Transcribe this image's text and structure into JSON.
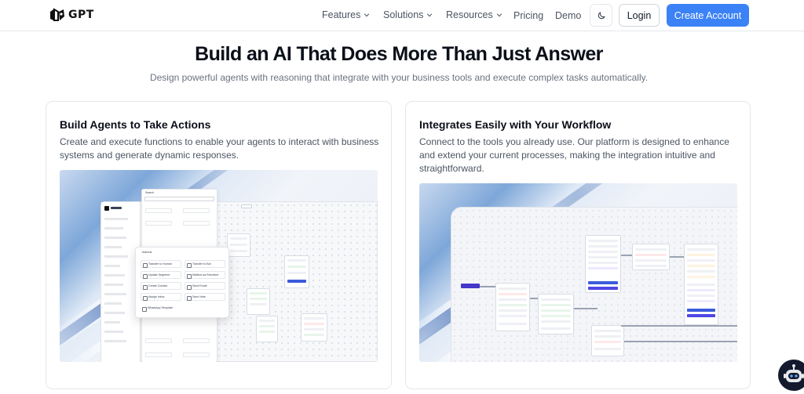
{
  "nav": {
    "logo_text": "GPT",
    "items": [
      {
        "label": "Features",
        "has_dropdown": true
      },
      {
        "label": "Solutions",
        "has_dropdown": true
      },
      {
        "label": "Resources",
        "has_dropdown": true
      },
      {
        "label": "Pricing",
        "has_dropdown": false
      },
      {
        "label": "Demo",
        "has_dropdown": false
      }
    ],
    "theme_icon": "moon-icon",
    "login_label": "Login",
    "create_account_label": "Create Account"
  },
  "hero": {
    "title": "Build an AI That Does More Than Just Answer",
    "subtitle": "Design powerful agents with reasoning that integrate with your business tools and execute complex tasks automatically."
  },
  "cards": [
    {
      "title": "Build Agents to Take Actions",
      "description": "Create and execute functions to enable your agents to interact with business systems and generate dynamic responses.",
      "screenshot": {
        "search_placeholder": "Search",
        "actions_header": "Actions",
        "actions": [
          "Transfer to Human",
          "Transfer to Bot",
          "Update Segment",
          "Mailbox as Resolved",
          "Create Contact",
          "Send Email",
          "Assign Inbox",
          "Save Note",
          "WhatsApp Template"
        ]
      }
    },
    {
      "title": "Integrates Easily with Your Workflow",
      "description": "Connect to the tools you already use. Our platform is designed to enhance and extend your current processes, making the integration intuitive and straightforward."
    }
  ],
  "chatbot": {
    "icon": "robot-icon"
  },
  "colors": {
    "accent": "#3b82f6",
    "node_button": "#3b5bdb",
    "title": "#0b0f19",
    "muted": "#6b7280"
  }
}
